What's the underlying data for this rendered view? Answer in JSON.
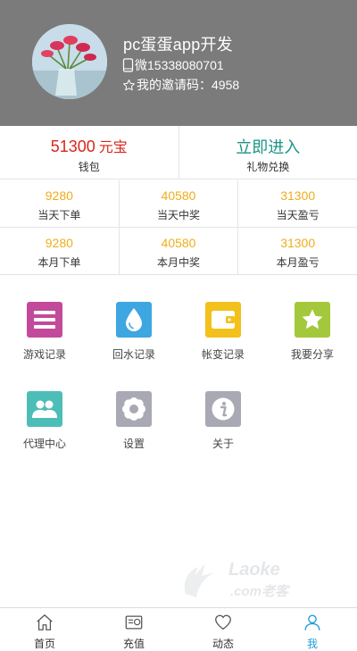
{
  "header": {
    "user_name": "pc蛋蛋app开发",
    "phone": "微15338080701",
    "invite": "我的邀请码：4958",
    "avatar_icon": "avatar-flower-image",
    "phone_icon": "phone-icon",
    "star_icon": "star-outline-icon"
  },
  "wallet": {
    "amount": "51300",
    "unit": "元宝",
    "label": "钱包",
    "enter": "立即进入",
    "gift_label": "礼物兑换"
  },
  "stats": [
    [
      {
        "value": "9280",
        "label": "当天下单"
      },
      {
        "value": "40580",
        "label": "当天中奖"
      },
      {
        "value": "31300",
        "label": "当天盈亏"
      }
    ],
    [
      {
        "value": "9280",
        "label": "本月下单"
      },
      {
        "value": "40580",
        "label": "本月中奖"
      },
      {
        "value": "31300",
        "label": "本月盈亏"
      }
    ]
  ],
  "menu": [
    {
      "label": "游戏记录",
      "icon": "list-icon",
      "color": "#c34a9a"
    },
    {
      "label": "回水记录",
      "icon": "water-drop-icon",
      "color": "#3ea6e0"
    },
    {
      "label": "帐变记录",
      "icon": "wallet-icon",
      "color": "#f3c11b"
    },
    {
      "label": "我要分享",
      "icon": "star-icon",
      "color": "#a4c83b"
    },
    {
      "label": "代理中心",
      "icon": "users-icon",
      "color": "#4dbdb8"
    },
    {
      "label": "设置",
      "icon": "gear-icon",
      "color": "#a9a9b5"
    },
    {
      "label": "关于",
      "icon": "info-icon",
      "color": "#a9a9b5"
    }
  ],
  "watermark": {
    "brand": "Laoke",
    "sub": ".com老客"
  },
  "tabbar": [
    {
      "label": "首页",
      "icon": "home-icon"
    },
    {
      "label": "充值",
      "icon": "recharge-icon"
    },
    {
      "label": "动态",
      "icon": "heart-icon"
    },
    {
      "label": "我",
      "icon": "user-icon"
    }
  ],
  "colors": {
    "header_bg": "#7b7b7b",
    "wallet_red": "#d9261c",
    "enter_green": "#1b9486",
    "stat_orange": "#f0ad1a",
    "active_blue": "#1f9cd9"
  }
}
